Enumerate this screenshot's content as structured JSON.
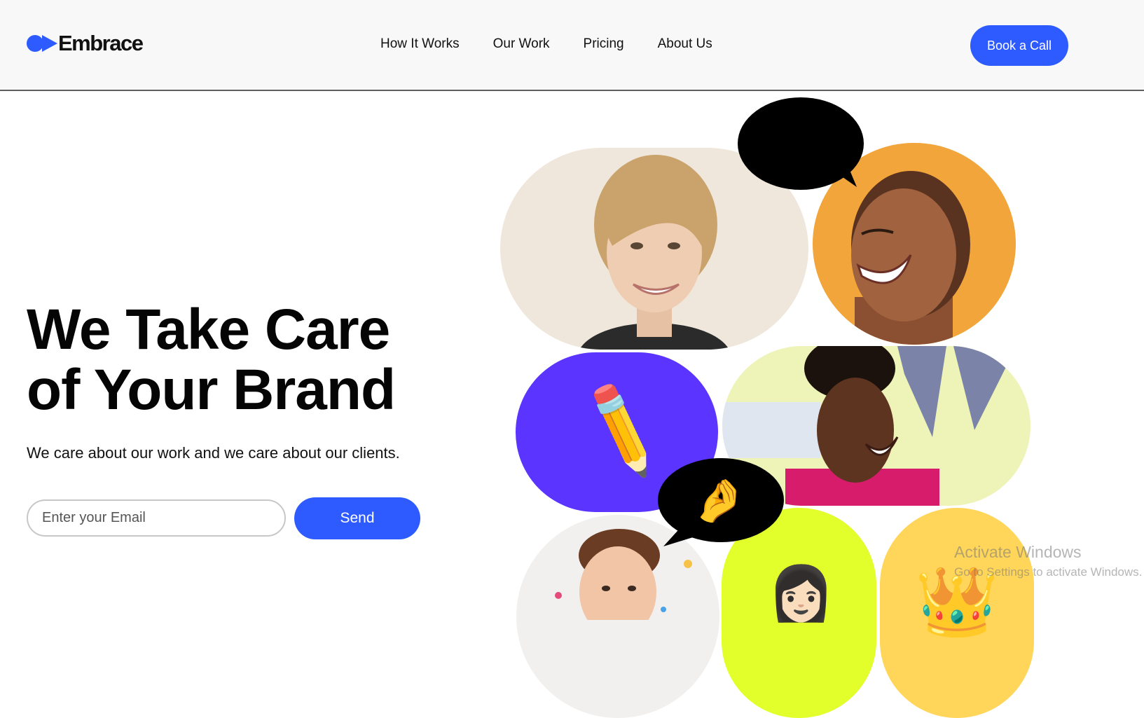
{
  "brand": {
    "name": "Embrace",
    "accent_color": "#2e5bff"
  },
  "nav": {
    "items": [
      {
        "label": "How It Works"
      },
      {
        "label": "Our Work"
      },
      {
        "label": "Pricing"
      },
      {
        "label": "About Us"
      }
    ],
    "cta_label": "Book a Call"
  },
  "hero": {
    "headline_line1": "We Take Care",
    "headline_line2": "of Your Brand",
    "subtitle": "We care about our work and we care about our clients.",
    "email_placeholder": "Enter your Email",
    "send_label": "Send"
  },
  "gallery": {
    "emojis": {
      "heart_eyes": "😍",
      "pencil": "✏️",
      "pinch": "🤌",
      "woman": "👩🏻",
      "crown": "👑"
    },
    "tile_colors": {
      "purple": "#5b35ff",
      "orange": "#f2a53a",
      "lime": "#e2ff2b",
      "yellow": "#ffd65a"
    }
  },
  "watermark": {
    "line1": "Activate Windows",
    "line2": "Go to Settings to activate Windows."
  }
}
